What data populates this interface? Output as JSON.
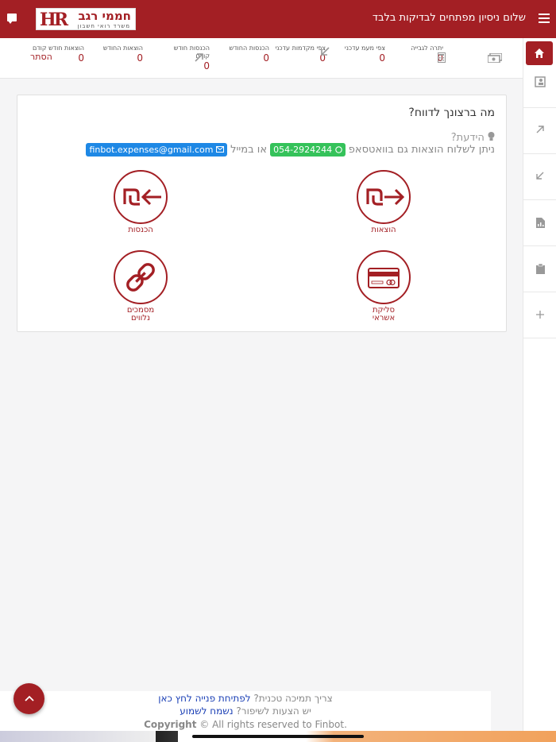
{
  "header": {
    "greeting": "שלום ניסיון מפתחים לבדיקות בלבד",
    "logo": {
      "name": "חממי רגב",
      "subtitle": "משרד רואי חשבון",
      "monogram": "HR"
    }
  },
  "stats": {
    "hide_label": "הסתר",
    "items": [
      {
        "label": "יתרה לגבייה",
        "value": "0"
      },
      {
        "label": "צפי מעמ עדכני",
        "value": "0"
      },
      {
        "label": "צפי מקדמות עדכני",
        "value": "0"
      },
      {
        "label": "הכנסות החודש",
        "value": "0"
      },
      {
        "label": "הכנסות חודש קודם",
        "value": "0"
      },
      {
        "label": "הוצאות החודש",
        "value": "0"
      },
      {
        "label": "הוצאות חודש קודם",
        "value": "0"
      }
    ]
  },
  "card": {
    "title": "מה ברצונך לדווח?",
    "tip_heading": "הידעת?",
    "tip_text": "ניתן לשלוח הוצאות גם בוואטסאפ",
    "whatsapp": "054-2924244",
    "or_email": "או במייל",
    "email": "finbot.expenses@gmail.com",
    "actions": {
      "expenses": "הוצאות",
      "income": "הכנסות",
      "credit": "סליקת אשראי",
      "linked_docs": "מסמכים נלווים"
    }
  },
  "footer": {
    "support_q": "צריך תמיכה טכנית?",
    "support_link": "לפתיחת פנייה לחץ כאן",
    "improve_q": "יש הצעות לשיפור?",
    "improve_link": "נשמח לשמוע",
    "copyright_brand": "Copyright",
    "copyright_rest": "© All rights reserved to Finbot."
  },
  "colors": {
    "brand": "#a31f24",
    "whatsapp": "#35c25a",
    "email": "#1e88e5"
  }
}
